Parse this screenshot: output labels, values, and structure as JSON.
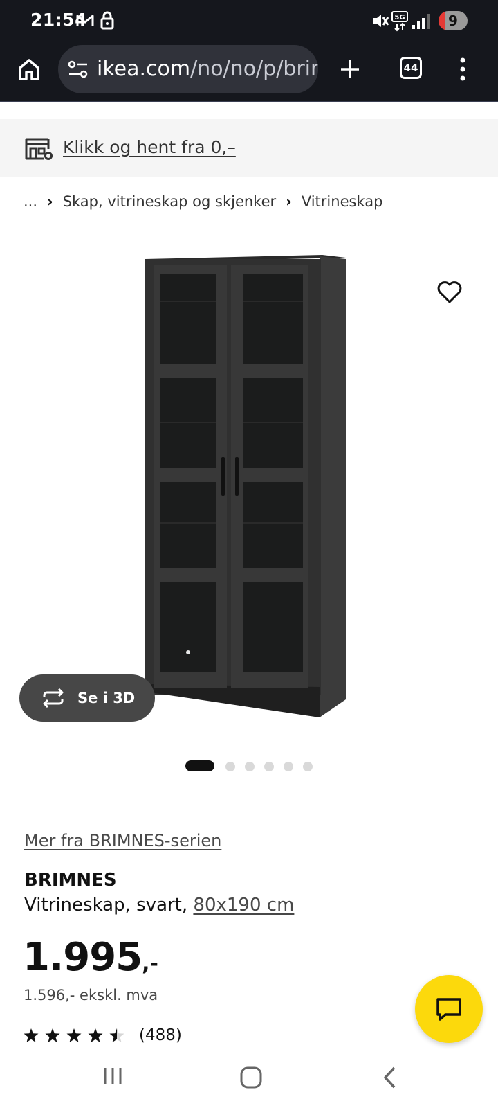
{
  "status_bar": {
    "time": "21:54",
    "badge_count": "9",
    "icons": [
      "gmail-icon",
      "lock-icon",
      "mute-icon",
      "5g-icon",
      "signal-icon"
    ]
  },
  "browser": {
    "url_host": "ikea.com",
    "url_path": "/no/no/p/brim",
    "tab_count": "44"
  },
  "banner": {
    "text": "Klikk og hent fra 0,–"
  },
  "breadcrumb": {
    "items": [
      "...",
      "Skap, vitrineskap og skjenker",
      "Vitrineskap"
    ]
  },
  "gallery": {
    "view_3d_label": "Se i 3D",
    "image_count": 6,
    "active_index": 0
  },
  "product": {
    "series_link": "Mer fra BRIMNES-serien",
    "name": "BRIMNES",
    "description": "Vitrineskap, svart, ",
    "size": "80x190 cm",
    "price_main": "1.995",
    "price_suffix": ",-",
    "price_ex_vat": "1.596,- ekskl. mva",
    "rating_value": 4.6,
    "rating_count": "(488)"
  },
  "colors": {
    "status_bar_bg": "#15171d",
    "banner_bg": "#f5f5f5",
    "chat_button": "#fcd90c",
    "view_3d_bg": "#474747"
  }
}
